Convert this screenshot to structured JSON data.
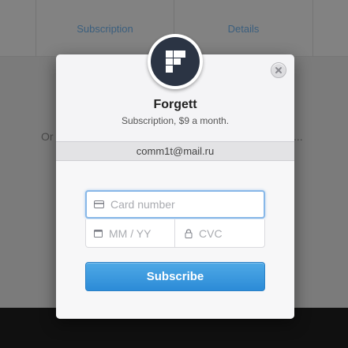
{
  "background": {
    "tabs": [
      "Subscription",
      "Details"
    ],
    "text_left": "Or",
    "text_right": "..."
  },
  "modal": {
    "logo_icon": "forgett-logo-icon",
    "title": "Forgett",
    "subtitle": "Subscription, $9 a month.",
    "email": "comm1t@mail.ru",
    "card_number_placeholder": "Card number",
    "expiry_placeholder": "MM / YY",
    "cvc_placeholder": "CVC",
    "subscribe_label": "Subscribe",
    "close_icon": "close-icon"
  },
  "colors": {
    "accent": "#3a9ae0",
    "logo_bg": "#2b3444",
    "focus_border": "#88b8e8"
  }
}
